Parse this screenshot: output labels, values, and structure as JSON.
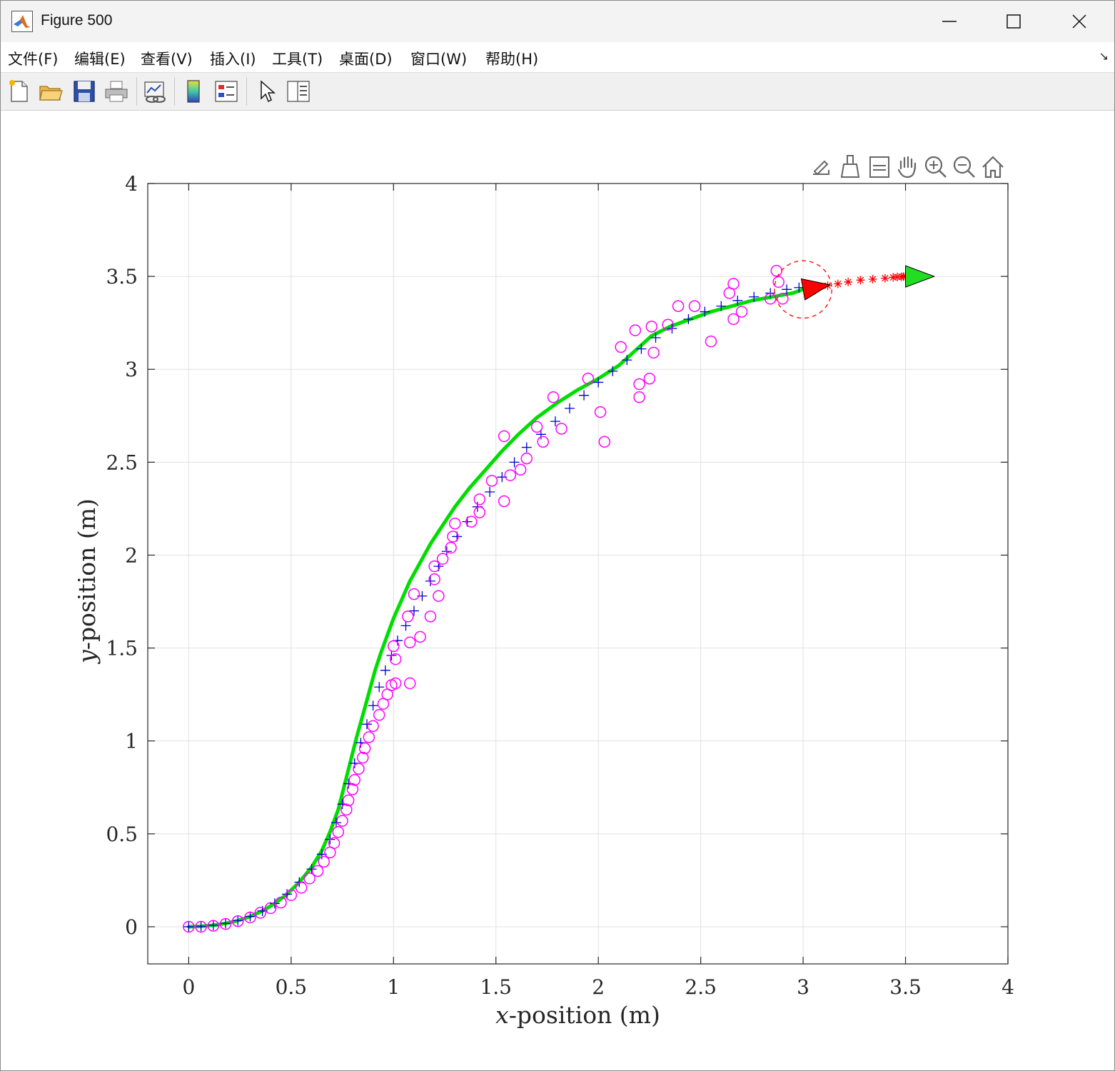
{
  "window": {
    "title": "Figure 500"
  },
  "menu": {
    "items": [
      "文件(F)",
      "编辑(E)",
      "查看(V)",
      "插入(I)",
      "工具(T)",
      "桌面(D)",
      "窗口(W)",
      "帮助(H)"
    ]
  },
  "toolbar": {
    "buttons": [
      "new-figure-icon",
      "open-file-icon",
      "save-icon",
      "print-icon",
      "link-plot-icon",
      "colorbar-icon",
      "legend-icon",
      "pointer-icon",
      "property-inspector-icon"
    ]
  },
  "axes_toolbar": {
    "buttons": [
      "export-icon",
      "brush-icon",
      "datatip-icon",
      "pan-hand-icon",
      "zoom-in-icon",
      "zoom-out-icon",
      "home-icon"
    ]
  },
  "colors": {
    "trajectory": "#00dd00",
    "measurements": "#ff00ff",
    "estimates": "#0000cc",
    "prediction": "#ff0000",
    "grid": "#e0e0e0"
  },
  "chart_data": {
    "type": "line",
    "xlabel_var": "x",
    "xlabel_rest": "-position (m)",
    "ylabel_var": "y",
    "ylabel_rest": "-position (m)",
    "xlim": [
      -0.2,
      4
    ],
    "ylim": [
      -0.2,
      4
    ],
    "xticks": [
      "0",
      "0.5",
      "1",
      "1.5",
      "2",
      "2.5",
      "3",
      "3.5",
      "4"
    ],
    "yticks": [
      "0",
      "0.5",
      "1",
      "1.5",
      "2",
      "2.5",
      "3",
      "3.5",
      "4"
    ],
    "grid": true,
    "series": [
      {
        "kind": "line",
        "color": "#00dd00",
        "x": [
          0,
          0.06,
          0.12,
          0.18,
          0.24,
          0.3,
          0.36,
          0.42,
          0.48,
          0.54,
          0.6,
          0.65,
          0.69,
          0.73,
          0.76,
          0.79,
          0.82,
          0.85,
          0.88,
          0.91,
          0.94,
          0.97,
          1.0,
          1.04,
          1.08,
          1.13,
          1.18,
          1.24,
          1.3,
          1.37,
          1.45,
          1.53,
          1.61,
          1.7,
          1.8,
          1.9,
          2.0,
          2.1,
          2.18,
          2.26,
          2.35,
          2.45,
          2.55,
          2.65,
          2.75,
          2.85,
          2.95,
          3.0
        ],
        "y": [
          0,
          0.002,
          0.008,
          0.018,
          0.033,
          0.055,
          0.085,
          0.125,
          0.175,
          0.24,
          0.32,
          0.41,
          0.51,
          0.63,
          0.76,
          0.89,
          1.02,
          1.14,
          1.26,
          1.38,
          1.48,
          1.57,
          1.66,
          1.76,
          1.86,
          1.96,
          2.06,
          2.16,
          2.26,
          2.36,
          2.46,
          2.56,
          2.65,
          2.74,
          2.82,
          2.89,
          2.95,
          3.02,
          3.1,
          3.18,
          3.23,
          3.27,
          3.31,
          3.34,
          3.37,
          3.39,
          3.41,
          3.43
        ]
      },
      {
        "kind": "markers-plus",
        "color": "#0000cc",
        "x": [
          0,
          0.06,
          0.12,
          0.18,
          0.24,
          0.3,
          0.36,
          0.42,
          0.48,
          0.54,
          0.6,
          0.65,
          0.69,
          0.72,
          0.75,
          0.78,
          0.81,
          0.84,
          0.87,
          0.9,
          0.93,
          0.96,
          0.99,
          1.02,
          1.06,
          1.1,
          1.14,
          1.18,
          1.22,
          1.26,
          1.31,
          1.36,
          1.41,
          1.47,
          1.53,
          1.59,
          1.65,
          1.72,
          1.79,
          1.86,
          1.93,
          2.0,
          2.07,
          2.14,
          2.21,
          2.28,
          2.36,
          2.44,
          2.52,
          2.6,
          2.68,
          2.76,
          2.84,
          2.92,
          2.98
        ],
        "y": [
          0,
          0.002,
          0.008,
          0.018,
          0.033,
          0.055,
          0.085,
          0.125,
          0.175,
          0.24,
          0.31,
          0.39,
          0.47,
          0.56,
          0.66,
          0.77,
          0.88,
          0.99,
          1.09,
          1.19,
          1.29,
          1.38,
          1.46,
          1.54,
          1.62,
          1.7,
          1.78,
          1.86,
          1.94,
          2.02,
          2.1,
          2.18,
          2.26,
          2.34,
          2.42,
          2.5,
          2.58,
          2.65,
          2.72,
          2.79,
          2.86,
          2.93,
          2.99,
          3.05,
          3.11,
          3.17,
          3.22,
          3.27,
          3.31,
          3.34,
          3.37,
          3.39,
          3.41,
          3.43,
          3.44
        ]
      },
      {
        "kind": "markers-circle",
        "color": "#ff00ff",
        "x": [
          0,
          0.06,
          0.12,
          0.18,
          0.24,
          0.3,
          0.35,
          0.4,
          0.45,
          0.5,
          0.55,
          0.59,
          0.63,
          0.66,
          0.69,
          0.71,
          0.73,
          0.75,
          0.77,
          0.78,
          0.8,
          0.81,
          0.83,
          0.85,
          0.86,
          0.88,
          0.9,
          0.93,
          0.95,
          0.97,
          0.99,
          1.0,
          1.01,
          1.01,
          1.07,
          1.08,
          1.08,
          1.1,
          1.13,
          1.18,
          1.2,
          1.22,
          1.2,
          1.24,
          1.28,
          1.3,
          1.29,
          1.38,
          1.42,
          1.42,
          1.48,
          1.54,
          1.57,
          1.54,
          1.62,
          1.65,
          1.7,
          1.73,
          1.78,
          1.82,
          1.95,
          2.01,
          2.03,
          2.11,
          2.18,
          2.2,
          2.2,
          2.25,
          2.26,
          2.27,
          2.34,
          2.39,
          2.47,
          2.55,
          2.64,
          2.66,
          2.66,
          2.7,
          2.84,
          2.87,
          2.88,
          2.9
        ],
        "y": [
          0,
          0.0,
          0.005,
          0.015,
          0.03,
          0.05,
          0.075,
          0.1,
          0.13,
          0.17,
          0.21,
          0.26,
          0.3,
          0.35,
          0.4,
          0.45,
          0.51,
          0.57,
          0.63,
          0.68,
          0.74,
          0.79,
          0.85,
          0.91,
          0.96,
          1.02,
          1.08,
          1.14,
          1.2,
          1.25,
          1.3,
          1.51,
          1.44,
          1.31,
          1.67,
          1.53,
          1.31,
          1.79,
          1.56,
          1.67,
          1.87,
          1.78,
          1.94,
          1.98,
          2.04,
          2.17,
          2.1,
          2.18,
          2.23,
          2.3,
          2.4,
          2.29,
          2.43,
          2.64,
          2.46,
          2.52,
          2.69,
          2.61,
          2.85,
          2.68,
          2.95,
          2.77,
          2.61,
          3.12,
          3.21,
          2.92,
          2.85,
          2.95,
          3.23,
          3.09,
          3.24,
          3.34,
          3.34,
          3.15,
          3.41,
          3.46,
          3.27,
          3.31,
          3.38,
          3.53,
          3.47,
          3.38
        ]
      },
      {
        "kind": "markers-star",
        "color": "#ff0000",
        "x": [
          3.12,
          3.17,
          3.22,
          3.28,
          3.34,
          3.4,
          3.44,
          3.46,
          3.48,
          3.49,
          3.5
        ],
        "y": [
          3.45,
          3.46,
          3.47,
          3.48,
          3.485,
          3.49,
          3.495,
          3.497,
          3.498,
          3.499,
          3.5
        ]
      }
    ],
    "annotations": [
      {
        "kind": "arrow",
        "color": "#ff0000",
        "x": 3.0,
        "y": 3.43,
        "tip_x": 3.13,
        "tip_y": 3.455
      },
      {
        "kind": "arrow",
        "color": "#22dd22",
        "x": 3.5,
        "y": 3.5,
        "tip_x": 3.64,
        "tip_y": 3.5
      },
      {
        "kind": "circle-dashed",
        "color": "#ff0000",
        "x": 3.0,
        "y": 3.43,
        "radius": 0.14
      }
    ]
  }
}
